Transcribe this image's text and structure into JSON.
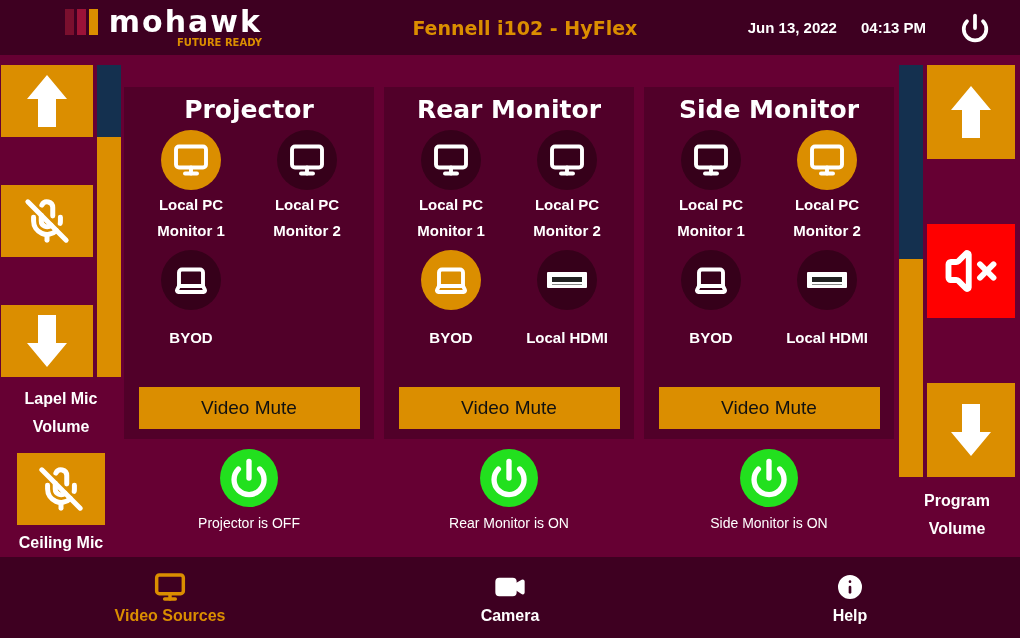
{
  "header": {
    "logo": {
      "name": "mohawk",
      "tagline": "FUTURE READY"
    },
    "room": "Fennell i102 - HyFlex",
    "date": "Jun 13, 2022",
    "time": "04:13 PM"
  },
  "lapel_mic": {
    "level": 0.77,
    "muted": false,
    "label": "Lapel Mic Volume"
  },
  "ceiling_mic": {
    "muted": false,
    "label": "Ceiling Mic"
  },
  "displays": [
    {
      "title": "Projector",
      "sources": [
        {
          "kind": "monitor",
          "label": "Local PC Monitor 1",
          "selected": true
        },
        {
          "kind": "monitor",
          "label": "Local PC Monitor 2",
          "selected": false
        },
        {
          "kind": "laptop",
          "label": "BYOD",
          "selected": false
        }
      ],
      "mute_button": "Video Mute",
      "status": "Projector is OFF"
    },
    {
      "title": "Rear Monitor",
      "sources": [
        {
          "kind": "monitor",
          "label": "Local PC Monitor 1",
          "selected": false
        },
        {
          "kind": "monitor",
          "label": "Local PC Monitor 2",
          "selected": false
        },
        {
          "kind": "laptop",
          "label": "BYOD",
          "selected": true
        },
        {
          "kind": "hdmi",
          "label": "Local HDMI",
          "selected": false
        }
      ],
      "mute_button": "Video Mute",
      "status": "Rear Monitor is ON"
    },
    {
      "title": "Side Monitor",
      "sources": [
        {
          "kind": "monitor",
          "label": "Local PC Monitor 1",
          "selected": false
        },
        {
          "kind": "monitor",
          "label": "Local PC Monitor 2",
          "selected": true
        },
        {
          "kind": "laptop",
          "label": "BYOD",
          "selected": false
        },
        {
          "kind": "hdmi",
          "label": "Local HDMI",
          "selected": false
        }
      ],
      "mute_button": "Video Mute",
      "status": "Side Monitor is ON"
    }
  ],
  "program_volume": {
    "level": 0.53,
    "muted": true,
    "label": "Program Volume"
  },
  "nav": [
    {
      "kind": "video",
      "label": "Video Sources",
      "selected": true
    },
    {
      "kind": "camera",
      "label": "Camera",
      "selected": false
    },
    {
      "kind": "help",
      "label": "Help",
      "selected": false
    }
  ]
}
